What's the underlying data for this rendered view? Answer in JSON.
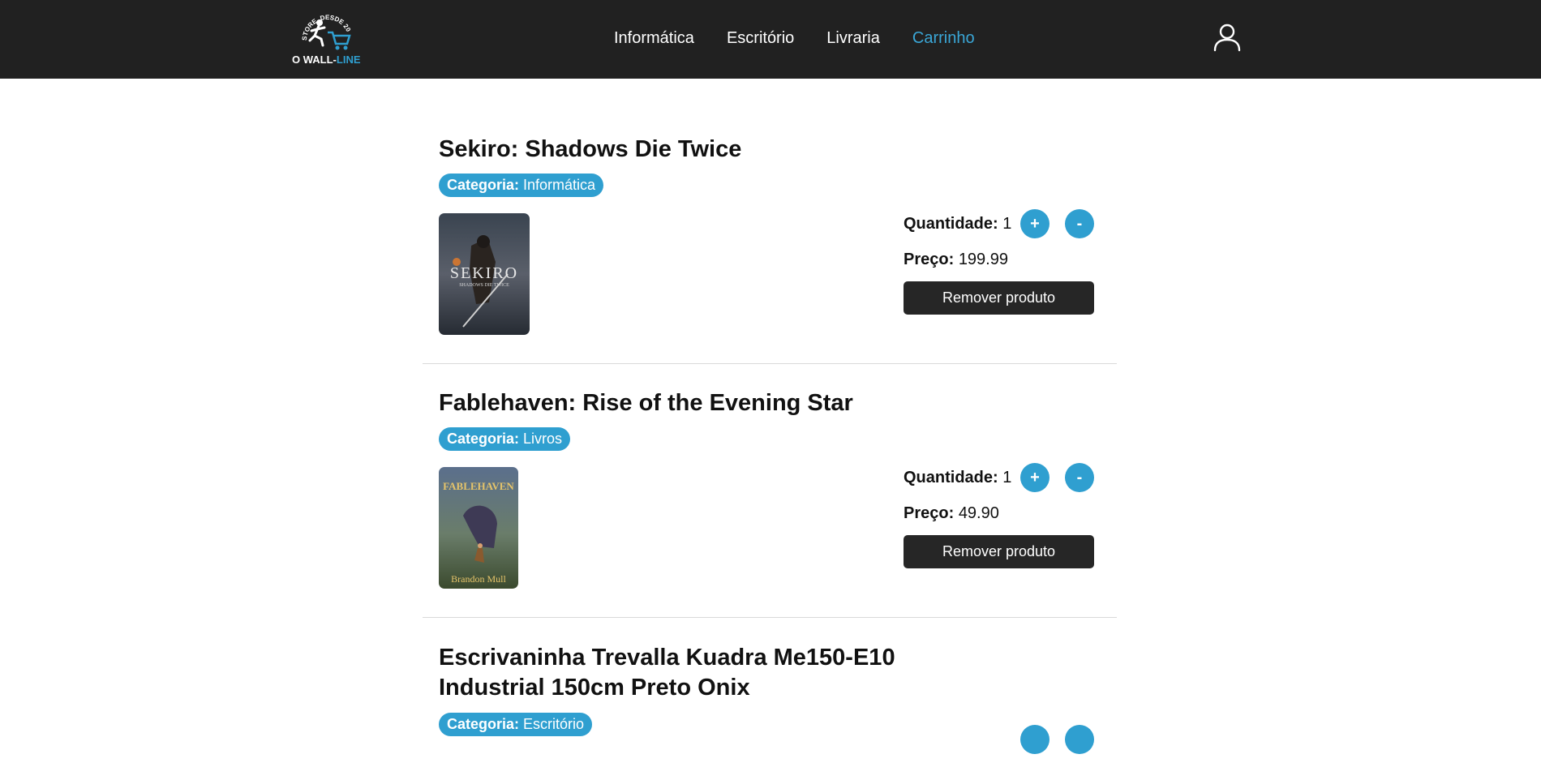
{
  "brand": {
    "arc_text": "STORE, DESDE 2021",
    "name_part1": "O WALL-",
    "name_part2": "LINE"
  },
  "nav": {
    "items": [
      {
        "label": "Informática",
        "active": false
      },
      {
        "label": "Escritório",
        "active": false
      },
      {
        "label": "Livraria",
        "active": false
      },
      {
        "label": "Carrinho",
        "active": true
      }
    ],
    "user_icon": "user-icon"
  },
  "cart": {
    "items": [
      {
        "title": "Sekiro: Shadows Die Twice",
        "category_label": "Categoria:",
        "category": "Informática",
        "cover_title": "SEKIRO",
        "cover_subtitle": "SHADOWS DIE TWICE",
        "quantity_label": "Quantidade:",
        "quantity": "1",
        "plus_label": "+",
        "minus_label": "-",
        "price_label": "Preço:",
        "price": "199.99",
        "remove_label": "Remover produto"
      },
      {
        "title": "Fablehaven: Rise of the Evening Star",
        "category_label": "Categoria:",
        "category": "Livros",
        "cover_title": "FABLEHAVEN",
        "cover_author": "Brandon Mull",
        "quantity_label": "Quantidade:",
        "quantity": "1",
        "plus_label": "+",
        "minus_label": "-",
        "price_label": "Preço:",
        "price": "49.90",
        "remove_label": "Remover produto"
      },
      {
        "title": "Escrivaninha Trevalla Kuadra Me150-E10 Industrial 150cm Preto Onix",
        "category_label": "Categoria:",
        "category": "Escritório"
      }
    ]
  },
  "colors": {
    "navbar_bg": "#212121",
    "accent": "#2f9fd0",
    "active_link": "#3aa6d6",
    "button_dark": "#262626"
  }
}
